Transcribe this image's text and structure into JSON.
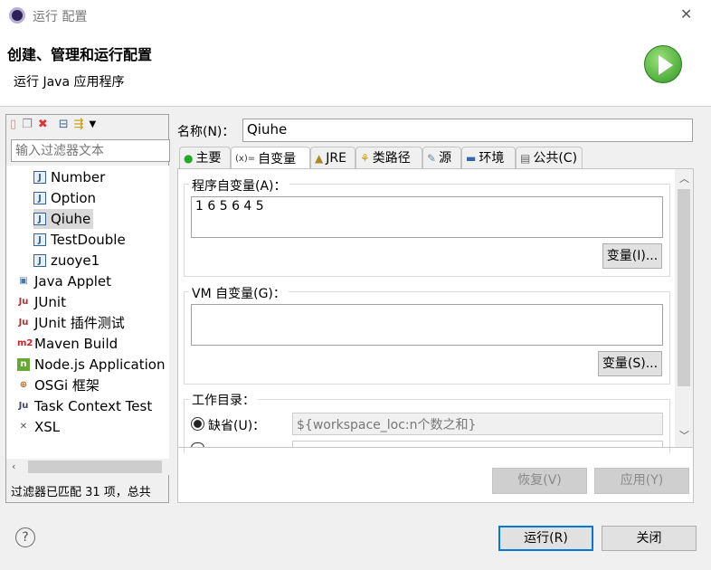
{
  "window": {
    "title": "运行 配置",
    "close": "✕"
  },
  "header": {
    "title": "创建、管理和运行配置",
    "subtitle": "运行 Java 应用程序"
  },
  "left": {
    "filter_placeholder": "输入过滤器文本",
    "items": [
      {
        "label": "Number",
        "icon": "java-class-icon",
        "level": 1
      },
      {
        "label": "Option",
        "icon": "java-class-icon",
        "level": 1
      },
      {
        "label": "Qiuhe",
        "icon": "java-class-icon",
        "level": 1,
        "selected": true
      },
      {
        "label": "TestDouble",
        "icon": "java-class-icon",
        "level": 1
      },
      {
        "label": "zuoye1",
        "icon": "java-class-icon",
        "level": 1
      },
      {
        "label": "Java Applet",
        "icon": "applet-icon",
        "level": 0
      },
      {
        "label": "JUnit",
        "icon": "junit-icon",
        "level": 0
      },
      {
        "label": "JUnit 插件测试",
        "icon": "junit-plugin-icon",
        "level": 0
      },
      {
        "label": "Maven Build",
        "icon": "maven-icon",
        "level": 0
      },
      {
        "label": "Node.js Application",
        "icon": "nodejs-icon",
        "level": 0
      },
      {
        "label": "OSGi 框架",
        "icon": "osgi-icon",
        "level": 0
      },
      {
        "label": "Task Context Test",
        "icon": "task-context-icon",
        "level": 0
      },
      {
        "label": "XSL",
        "icon": "xsl-icon",
        "level": 0
      }
    ],
    "status": "过滤器已匹配 31 项，总共"
  },
  "main": {
    "name_label": "名称(N)：",
    "name_value": "Qiuhe",
    "tabs": [
      {
        "label": "主要"
      },
      {
        "label": "自变量",
        "selected": true
      },
      {
        "label": "JRE"
      },
      {
        "label": "类路径"
      },
      {
        "label": "源"
      },
      {
        "label": "环境"
      },
      {
        "label": "公共(C)"
      }
    ],
    "program_args_label": "程序自变量(A)：",
    "program_args_value": "1 6 5 6 4 5",
    "program_vars_button": "变量(I)...",
    "vm_args_label": "VM 自变量(G)：",
    "vm_args_value": "",
    "vm_vars_button": "变量(S)...",
    "workdir_label": "工作目录：",
    "default_label": "缺省(U)：",
    "default_value": "${workspace_loc:n个数之和}",
    "revert_button": "恢复(V)",
    "apply_button": "应用(Y)"
  },
  "footer": {
    "help": "?",
    "run_button": "运行(R)",
    "close_button": "关闭"
  }
}
